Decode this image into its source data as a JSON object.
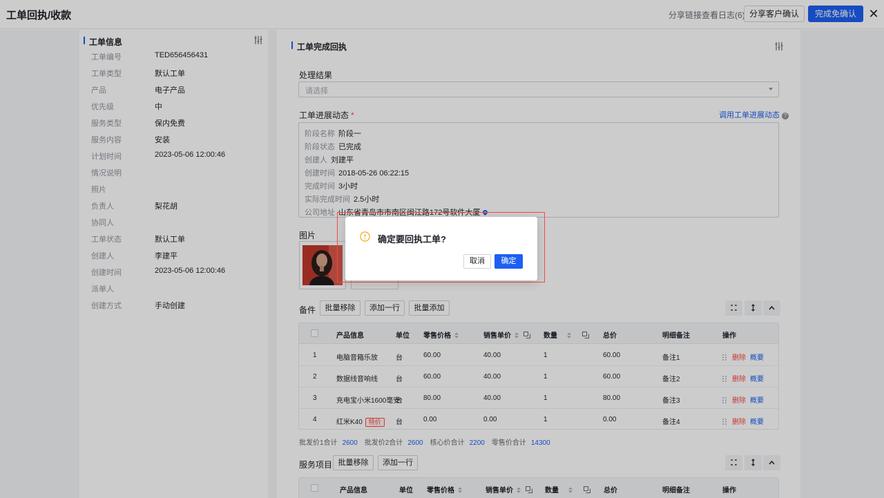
{
  "header": {
    "title": "工单回执/收款",
    "share_log": "分享链接查看日志(6)",
    "share_confirm_button": "分享客户确认",
    "complete_confirm_button": "完成免确认"
  },
  "left_panel": {
    "section_title": "工单信息",
    "fields": [
      {
        "label": "工单编号",
        "value": "TED656456431"
      },
      {
        "label": "工单类型",
        "value": "默认工单"
      },
      {
        "label": "产品",
        "value": "电子产品"
      },
      {
        "label": "优先级",
        "value": "中"
      },
      {
        "label": "服务类型",
        "value": "保内免费"
      },
      {
        "label": "服务内容",
        "value": "安装"
      },
      {
        "label": "计划时间",
        "value": "2023-05-06 12:00:46"
      },
      {
        "label": "情况说明",
        "value": ""
      },
      {
        "label": "照片",
        "value": ""
      },
      {
        "label": "负责人",
        "value": "梨花胡"
      },
      {
        "label": "协同人",
        "value": ""
      },
      {
        "label": "工单状态",
        "value": "默认工单"
      },
      {
        "label": "创建人",
        "value": "李建平"
      },
      {
        "label": "创建时间",
        "value": "2023-05-06 12:00:46"
      },
      {
        "label": "派单人",
        "value": ""
      },
      {
        "label": "创建方式",
        "value": "手动创建"
      }
    ]
  },
  "right_panel": {
    "section_title": "工单完成回执",
    "result_label": "处理结果",
    "result_placeholder": "请选择",
    "progress_label": "工单进展动态",
    "progress_required": "*",
    "progress_link": "调用工单进展动态",
    "progress_rows": [
      {
        "label": "阶段名称",
        "value": "阶段一"
      },
      {
        "label": "阶段状态",
        "value": "已完成"
      },
      {
        "label": "创建人",
        "value": "刘建平"
      },
      {
        "label": "创建时间",
        "value": "2018-05-26 06:22:15"
      },
      {
        "label": "完成时间",
        "value": "3小时"
      },
      {
        "label": "实际完成时间",
        "value": "2.5小时"
      },
      {
        "label": "公司地址",
        "value": "山东省青岛市市南区闽江路172号软件大厦"
      }
    ],
    "photo_label": "图片",
    "parts": {
      "label": "备件",
      "buttons": [
        "批量移除",
        "添加一行",
        "批量添加"
      ],
      "columns": [
        "产品信息",
        "单位",
        "零售价格",
        "销售单价",
        "数量",
        "总价",
        "明细备注",
        "操作"
      ],
      "rows": [
        {
          "no": "1",
          "product": "电脑音箱乐放",
          "tag": "",
          "unit": "台",
          "retail": "60.00",
          "sale": "40.00",
          "qty": "1",
          "total": "60.00",
          "note": "备注1"
        },
        {
          "no": "2",
          "product": "数据线音响线",
          "tag": "",
          "unit": "台",
          "retail": "60.00",
          "sale": "40.00",
          "qty": "1",
          "total": "60.00",
          "note": "备注2"
        },
        {
          "no": "3",
          "product": "充电宝小米1600毫安",
          "tag": "",
          "unit": "台",
          "retail": "80.00",
          "sale": "40.00",
          "qty": "1",
          "total": "80.00",
          "note": "备注3"
        },
        {
          "no": "4",
          "product": "红米K40",
          "tag": "特价",
          "unit": "台",
          "retail": "0.00",
          "sale": "0.00",
          "qty": "1",
          "total": "0.00",
          "note": "备注4"
        }
      ],
      "action_delete": "删除",
      "action_view": "概要",
      "summary": [
        {
          "label": "批发价1合计",
          "value": "2600"
        },
        {
          "label": "批发价2合计",
          "value": "2600"
        },
        {
          "label": "核心价合计",
          "value": "2200"
        },
        {
          "label": "零售价合计",
          "value": "14300"
        }
      ]
    },
    "services": {
      "label": "服务项目",
      "buttons": [
        "批量移除",
        "添加一行"
      ],
      "columns": [
        "产品信息",
        "单位",
        "零售价格",
        "销售单价",
        "数量",
        "总价",
        "明细备注",
        "操作"
      ]
    }
  },
  "dialog": {
    "title": "确定要回执工单?",
    "cancel": "取消",
    "ok": "确定"
  },
  "colors": {
    "primary": "#1d5ff2",
    "danger": "#f54a45",
    "warning": "#f5a623"
  }
}
